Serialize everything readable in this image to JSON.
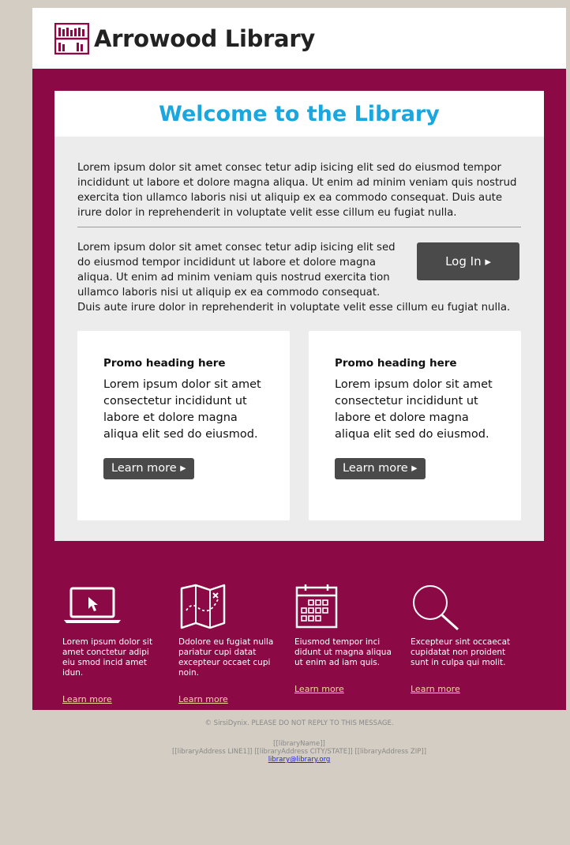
{
  "header": {
    "library_name": "Arrowood Library"
  },
  "hero": {
    "title": "Welcome to the Library",
    "intro_text": "Lorem ipsum dolor sit amet consec tetur adip isicing elit sed do eiusmod tempor incididunt ut labore et dolore magna aliqua. Ut enim ad minim veniam quis nostrud exercita tion ullamco laboris nisi ut aliquip ex ea commodo consequat. Duis aute irure dolor in reprehenderit in voluptate velit esse cillum eu fugiat nulla.",
    "login_text": "Lorem ipsum dolor sit amet consec tetur adip isicing elit sed do eiusmod tempor incididunt ut labore et dolore magna aliqua. Ut enim ad minim veniam quis nostrud exercita tion ullamco laboris nisi ut aliquip ex ea commodo consequat. Duis aute irure dolor in reprehenderit in voluptate velit esse cillum eu fugiat nulla.",
    "login_label": "Log In ▸"
  },
  "promos": [
    {
      "heading": "Promo heading here",
      "text": "Lorem ipsum dolor sit amet consectetur incididunt ut labore et dolore magna aliqua elit sed do eiusmod.",
      "button_label": "Learn more ▸"
    },
    {
      "heading": "Promo heading here",
      "text": "Lorem ipsum dolor sit amet consectetur incididunt ut labore et dolore magna aliqua elit sed do eiusmod.",
      "button_label": "Learn more ▸"
    }
  ],
  "features": [
    {
      "icon": "laptop-icon",
      "text": "Lorem ipsum dolor sit amet conctetur adipi eiu smod incid amet idun.",
      "link": "Learn more"
    },
    {
      "icon": "map-icon",
      "text": "Ddolore eu fugiat nulla pariatur cupi datat excepteur occaet cupi noin.",
      "link": "Learn more"
    },
    {
      "icon": "calendar-icon",
      "text": "Eiusmod tempor inci didunt ut magna aliqua ut enim ad iam quis.",
      "link": "Learn more"
    },
    {
      "icon": "search-icon",
      "text": "Excepteur sint occaecat cupidatat non proident sunt in culpa qui molit.",
      "link": "Learn more"
    }
  ],
  "footer": {
    "copyright": "© SirsiDynix. PLEASE DO NOT REPLY TO THIS MESSAGE.",
    "library_name_token": "[[libraryName]]",
    "address_line": "[[libraryAddress LINE1]] [[libraryAddress CITY/STATE]] [[libraryAddress ZIP]]",
    "email": "library@library.org"
  },
  "colors": {
    "brand": "#8b0a46",
    "title_accent": "#1aa7e0",
    "button": "#4a4a4a",
    "page_background": "#d4cdc3",
    "link": "#f3d6a0"
  }
}
